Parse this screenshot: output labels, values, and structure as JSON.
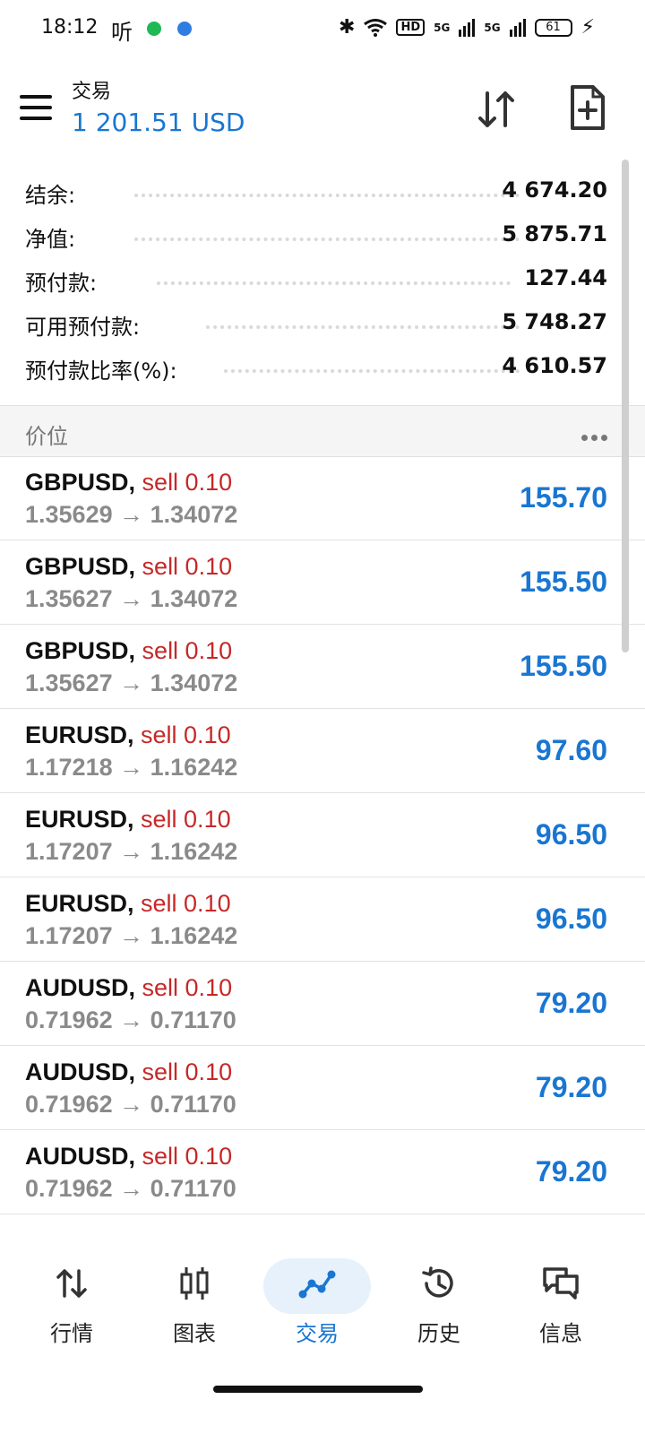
{
  "status_bar": {
    "time": "18:12",
    "ting": "听",
    "hd": "HD",
    "signal1": "5G",
    "signal2": "5G",
    "battery": "61"
  },
  "app_bar": {
    "title": "交易",
    "balance": "1 201.51 USD"
  },
  "summary": [
    {
      "label": "结余:",
      "value": "4 674.20"
    },
    {
      "label": "净值:",
      "value": "5 875.71"
    },
    {
      "label": "预付款:",
      "value": "127.44"
    },
    {
      "label": "可用预付款:",
      "value": "5 748.27"
    },
    {
      "label": "预付款比率(%):",
      "value": "4 610.57"
    }
  ],
  "section": {
    "title": "价位"
  },
  "positions": [
    {
      "symbol": "GBPUSD,",
      "side": "sell 0.10",
      "open": "1.35629",
      "arrow": "→",
      "current": "1.34072",
      "profit": "155.70"
    },
    {
      "symbol": "GBPUSD,",
      "side": "sell 0.10",
      "open": "1.35627",
      "arrow": "→",
      "current": "1.34072",
      "profit": "155.50"
    },
    {
      "symbol": "GBPUSD,",
      "side": "sell 0.10",
      "open": "1.35627",
      "arrow": "→",
      "current": "1.34072",
      "profit": "155.50"
    },
    {
      "symbol": "EURUSD,",
      "side": "sell 0.10",
      "open": "1.17218",
      "arrow": "→",
      "current": "1.16242",
      "profit": "97.60"
    },
    {
      "symbol": "EURUSD,",
      "side": "sell 0.10",
      "open": "1.17207",
      "arrow": "→",
      "current": "1.16242",
      "profit": "96.50"
    },
    {
      "symbol": "EURUSD,",
      "side": "sell 0.10",
      "open": "1.17207",
      "arrow": "→",
      "current": "1.16242",
      "profit": "96.50"
    },
    {
      "symbol": "AUDUSD,",
      "side": "sell 0.10",
      "open": "0.71962",
      "arrow": "→",
      "current": "0.71170",
      "profit": "79.20"
    },
    {
      "symbol": "AUDUSD,",
      "side": "sell 0.10",
      "open": "0.71962",
      "arrow": "→",
      "current": "0.71170",
      "profit": "79.20"
    },
    {
      "symbol": "AUDUSD,",
      "side": "sell 0.10",
      "open": "0.71962",
      "arrow": "→",
      "current": "0.71170",
      "profit": "79.20"
    }
  ],
  "nav": [
    {
      "label": "行情",
      "icon": "quotes-icon"
    },
    {
      "label": "图表",
      "icon": "chart-icon"
    },
    {
      "label": "交易",
      "icon": "trade-icon",
      "active": true
    },
    {
      "label": "历史",
      "icon": "history-icon"
    },
    {
      "label": "信息",
      "icon": "messages-icon"
    }
  ],
  "colors": {
    "accent": "#1976d2",
    "sell": "#c62828",
    "muted": "#8a8a8a"
  }
}
